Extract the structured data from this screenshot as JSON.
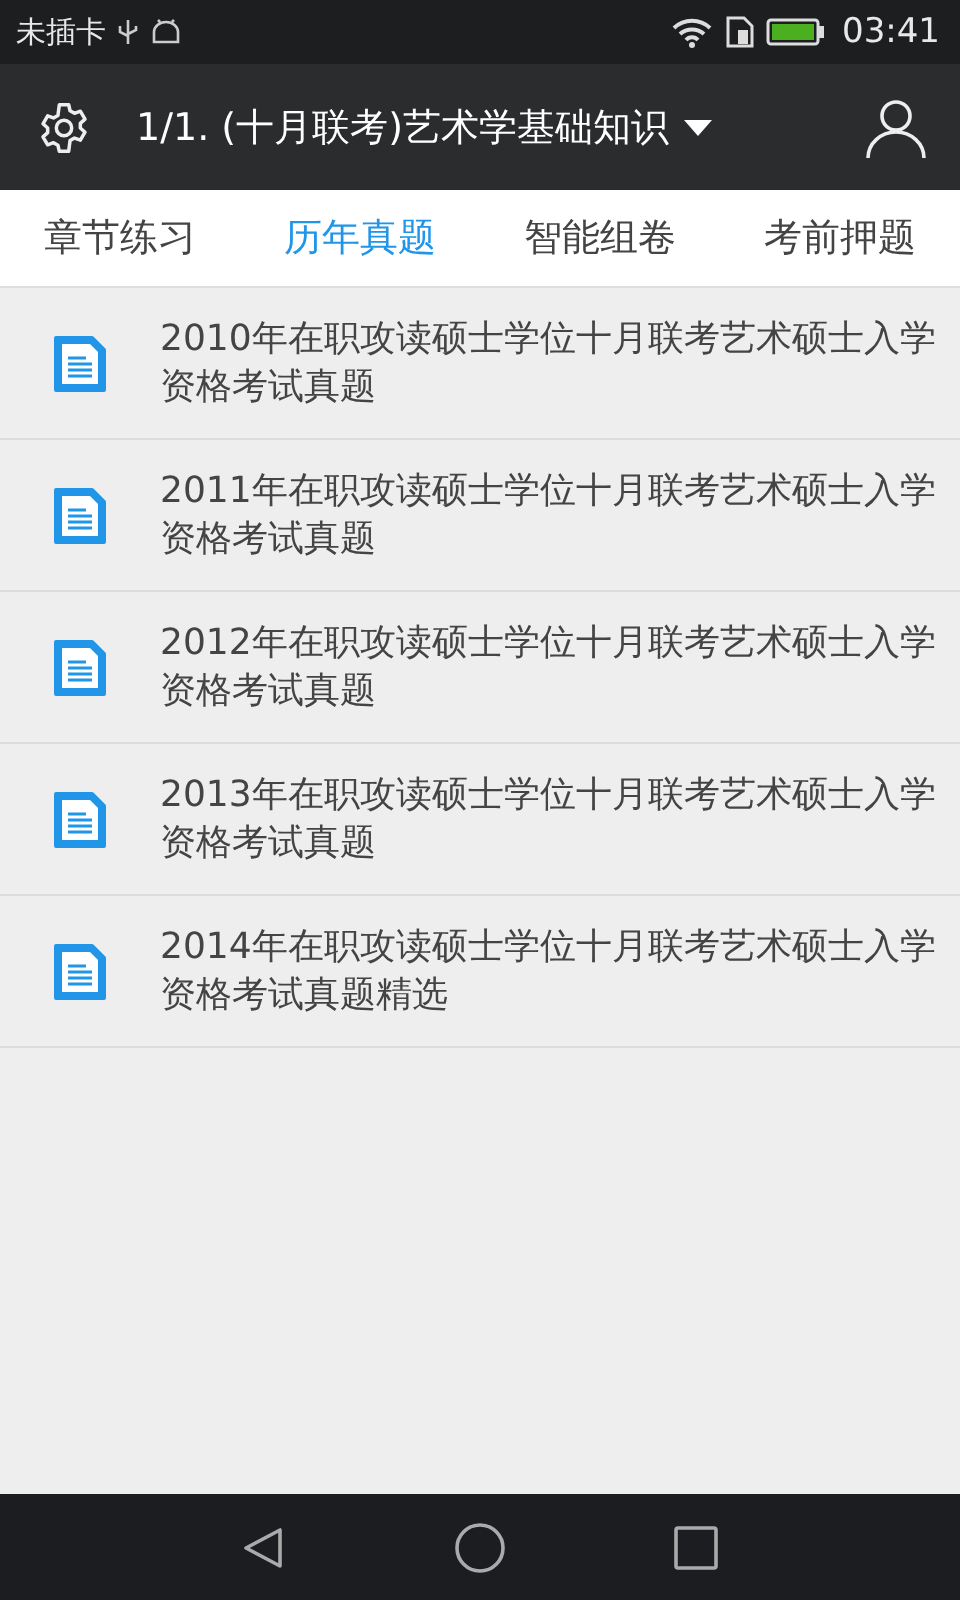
{
  "status_bar": {
    "carrier": "未插卡",
    "time": "03:41"
  },
  "app_bar": {
    "title": "1/1. (十月联考)艺术学基础知识"
  },
  "tabs": [
    {
      "label": "章节练习",
      "selected": false
    },
    {
      "label": "历年真题",
      "selected": true
    },
    {
      "label": "智能组卷",
      "selected": false
    },
    {
      "label": "考前押题",
      "selected": false
    }
  ],
  "papers": [
    {
      "title": "2010年在职攻读硕士学位十月联考艺术硕士入学资格考试真题"
    },
    {
      "title": "2011年在职攻读硕士学位十月联考艺术硕士入学资格考试真题"
    },
    {
      "title": "2012年在职攻读硕士学位十月联考艺术硕士入学资格考试真题"
    },
    {
      "title": "2013年在职攻读硕士学位十月联考艺术硕士入学资格考试真题"
    },
    {
      "title": "2014年在职攻读硕士学位十月联考艺术硕士入学资格考试真题精选"
    }
  ]
}
